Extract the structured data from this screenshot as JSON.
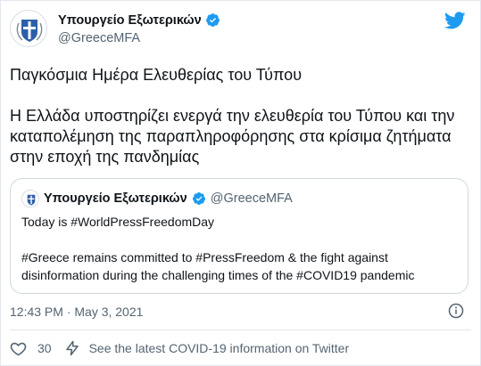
{
  "author": {
    "name": "Υπουργείο Εξωτερικών",
    "handle": "@GreeceMFA"
  },
  "tweet": {
    "paragraphs": [
      "Παγκόσμια Ημέρα Ελευθερίας του Τύπου",
      "Η Ελλάδα υποστηρίζει ενεργά την ελευθερία του Τύπου και την καταπολέμηση της παραπληροφόρησης στα κρίσιμα ζητήματα στην εποχή της πανδημίας"
    ]
  },
  "quote": {
    "name": "Υπουργείο Εξωτερικών",
    "handle": "@GreeceMFA",
    "paragraphs": [
      "Today is #WorldPressFreedomDay",
      "#Greece remains committed to #PressFreedom & the fight against disinformation during the challenging times of the #COVID19 pandemic"
    ]
  },
  "meta": {
    "timestamp": "12:43 PM · May 3, 2021"
  },
  "actions": {
    "like_count": "30",
    "covid_info": "See the latest COVID-19 information on Twitter"
  },
  "colors": {
    "twitter_blue": "#1d9bf0",
    "text": "#0f1419",
    "secondary": "#536471"
  },
  "icons": [
    "twitter-logo-icon",
    "verified-badge-icon",
    "info-icon",
    "heart-icon",
    "lightning-icon"
  ]
}
